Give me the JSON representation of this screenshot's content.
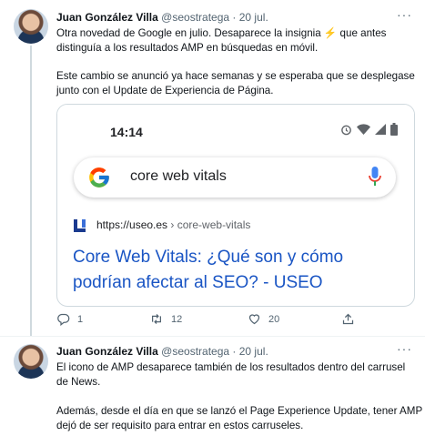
{
  "tweet1": {
    "name": "Juan González Villa",
    "handle": "@seostratega",
    "sep": "·",
    "date": "20 jul.",
    "line1": "Otra novedad de Google en julio. Desaparece la insignia ⚡ que antes",
    "line2": "distinguía a los resultados AMP en búsquedas en móvil.",
    "line3": "Este cambio se anunció ya hace semanas y se esperaba que se desplegase",
    "line4": "junto con el Update de Experiencia de Página.",
    "card": {
      "time": "14:14",
      "query": "core web vitals",
      "url_domain": "https://useo.es",
      "url_path": " › core-web-vitals",
      "title_line1": "Core Web Vitals: ¿Qué son y cómo",
      "title_line2": "podrían afectar al SEO? - USEO"
    },
    "actions": {
      "replies": "1",
      "retweets": "12",
      "likes": "20"
    }
  },
  "tweet2": {
    "name": "Juan González Villa",
    "handle": "@seostratega",
    "sep": "·",
    "date": "20 jul.",
    "line1": "El icono de AMP desaparece también de los resultados dentro del carrusel",
    "line2": "de News.",
    "line3": "Además, desde el día en que se lanzó el Page Experience Update, tener AMP",
    "line4": "dejó de ser requisito para entrar en estos carruseles."
  },
  "more_label": "···",
  "colors": {
    "link": "#1a55c4",
    "muted": "#536471",
    "border": "#cfd9de",
    "mic": "#4285f4"
  },
  "icons": [
    "more-icon",
    "google-g-icon",
    "mic-icon",
    "alarm-icon",
    "wifi-icon",
    "signal-icon",
    "battery-icon",
    "useo-favicon-icon",
    "reply-icon",
    "retweet-icon",
    "like-icon",
    "share-icon"
  ]
}
